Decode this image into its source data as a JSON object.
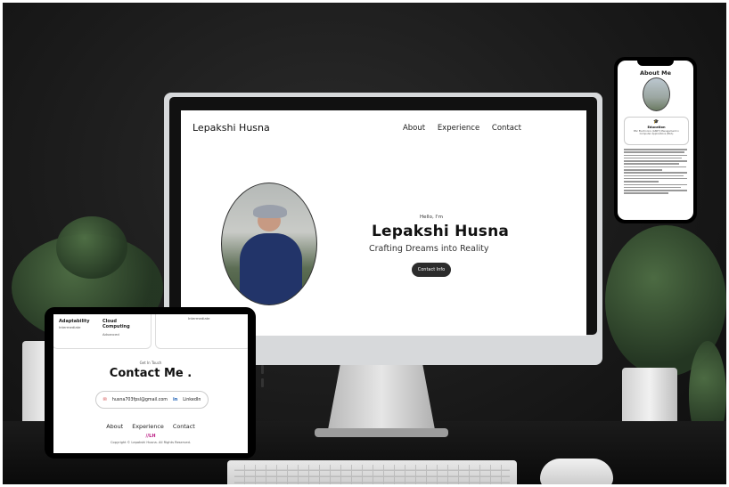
{
  "desktop_site": {
    "logo": "Lepakshi Husna",
    "nav": [
      "About",
      "Experience",
      "Contact"
    ],
    "greeting": "Hello, I'm",
    "name": "Lepakshi Husna",
    "tagline": "Crafting Dreams into Reality",
    "info_button": "Contact Info"
  },
  "phone_site": {
    "section_title": "About Me",
    "card_icon": "graduation-cap-icon",
    "card_title": "Education",
    "card_text": "BSc Electronics (GNIIT) Management in Computer Applications (BCA)"
  },
  "tablet_site": {
    "skills": [
      {
        "title": "Adaptability",
        "level": "Intermediate"
      },
      {
        "title": "Cloud Computing",
        "level": "Advanced"
      }
    ],
    "skill_fragment": "Intermediate",
    "get_in_touch": "Get In Touch",
    "contact_heading": "Contact Me .",
    "email": "husna703fpsl@gmail.com",
    "linkedin": "LinkedIn",
    "nav": [
      "About",
      "Experience",
      "Contact"
    ],
    "monogram": "//LH",
    "copyright": "Copyright © Lepakshi Husna. All Rights Reserved."
  },
  "colors": {
    "background": "#1a1a1a",
    "button": "#2c2c2c",
    "accent": "#b8127e"
  }
}
